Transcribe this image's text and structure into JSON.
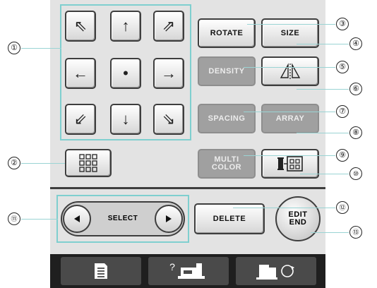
{
  "buttons": {
    "rotate": "ROTATE",
    "size": "SIZE",
    "density": "DENSITY",
    "spacing": "SPACING",
    "array": "ARRAY",
    "multi_color_line1": "MULTI",
    "multi_color_line2": "COLOR",
    "delete": "DELETE",
    "edit_end_line1": "EDIT",
    "edit_end_line2": "END",
    "select": "SELECT"
  },
  "arrows": {
    "up_left": "⇖",
    "up": "↑",
    "up_right": "⇗",
    "left": "←",
    "center": "•",
    "right": "→",
    "down_left": "⇙",
    "down": "↓",
    "down_right": "⇘"
  },
  "callouts": [
    "①",
    "②",
    "③",
    "④",
    "⑤",
    "⑥",
    "⑦",
    "⑧",
    "⑨",
    "⑩",
    "⑪",
    "⑫",
    "⑬"
  ],
  "bottom_tabs": {
    "tab2_label": "?"
  },
  "icons": [
    "arrow-up-left-icon",
    "arrow-up-icon",
    "arrow-up-right-icon",
    "arrow-left-icon",
    "center-dot-icon",
    "arrow-right-icon",
    "arrow-down-left-icon",
    "arrow-down-icon",
    "arrow-down-right-icon",
    "grid-icon",
    "mirror-icon",
    "thread-frame-icon",
    "triangle-left-icon",
    "triangle-right-icon",
    "list-icon",
    "machine-help-icon",
    "embroidery-unit-icon"
  ],
  "colors": {
    "panel": "#e3e3e3",
    "highlight": "#7fcfcf",
    "gray_button": "#a0a0a0",
    "dark": "#1f1f1f"
  }
}
